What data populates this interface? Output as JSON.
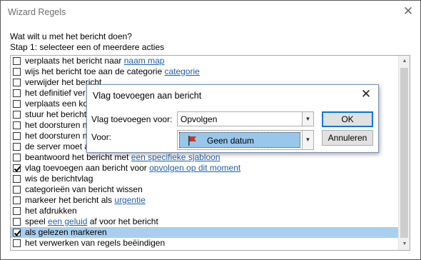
{
  "window": {
    "title": "Wizard Regels",
    "close_glyph": "✕"
  },
  "question": "Wat wilt u met het bericht doen?",
  "step": "Stap 1: selecteer een of meerdere acties",
  "actions": [
    {
      "text": "verplaats het bericht naar ",
      "link": "naam map",
      "after": "",
      "checked": false,
      "selected": false
    },
    {
      "text": "wijs het bericht toe aan de categorie ",
      "link": "categorie",
      "after": "",
      "checked": false,
      "selected": false
    },
    {
      "text": "verwijder het bericht",
      "link": "",
      "after": "",
      "checked": false,
      "selected": false
    },
    {
      "text": "het definitief ver",
      "link": "",
      "after": "",
      "checked": false,
      "selected": false
    },
    {
      "text": "verplaats een ko",
      "link": "",
      "after": "",
      "checked": false,
      "selected": false
    },
    {
      "text": "stuur het bericht",
      "link": "",
      "after": "",
      "checked": false,
      "selected": false
    },
    {
      "text": "het doorsturen n",
      "link": "",
      "after": "",
      "checked": false,
      "selected": false
    },
    {
      "text": "het doorsturen n",
      "link": "",
      "after": "",
      "checked": false,
      "selected": false
    },
    {
      "text": "de server moet a",
      "link": "",
      "after": "",
      "checked": false,
      "selected": false
    },
    {
      "text": "beantwoord het bericht met ",
      "link": "een specifieke sjabloon",
      "after": "",
      "checked": false,
      "selected": false
    },
    {
      "text": "vlag toevoegen aan bericht voor ",
      "link": "opvolgen op dit moment",
      "after": "",
      "checked": true,
      "selected": false
    },
    {
      "text": "wis de berichtvlag",
      "link": "",
      "after": "",
      "checked": false,
      "selected": false
    },
    {
      "text": "categorieën van bericht wissen",
      "link": "",
      "after": "",
      "checked": false,
      "selected": false
    },
    {
      "text": "markeer het bericht als ",
      "link": "urgentie",
      "after": "",
      "checked": false,
      "selected": false
    },
    {
      "text": "het afdrukken",
      "link": "",
      "after": "",
      "checked": false,
      "selected": false
    },
    {
      "text": "speel ",
      "link": "een geluid",
      "after": " af voor het bericht",
      "checked": false,
      "selected": false
    },
    {
      "text": "als gelezen markeren",
      "link": "",
      "after": "",
      "checked": true,
      "selected": true
    },
    {
      "text": "het verwerken van regels beëindigen",
      "link": "",
      "after": "",
      "checked": false,
      "selected": false
    }
  ],
  "scrollbar": {
    "up_glyph": "▲",
    "down_glyph": "▼"
  },
  "dialog": {
    "title": "Vlag toevoegen aan bericht",
    "close_glyph": "✕",
    "flag_label": "Vlag toevoegen voor:",
    "flag_value": "Opvolgen",
    "due_label": "Voor:",
    "due_value": "Geen datum",
    "dropdown_glyph": "▼",
    "ok_label": "OK",
    "cancel_label": "Annuleren",
    "flag_color": "#c0392b"
  }
}
